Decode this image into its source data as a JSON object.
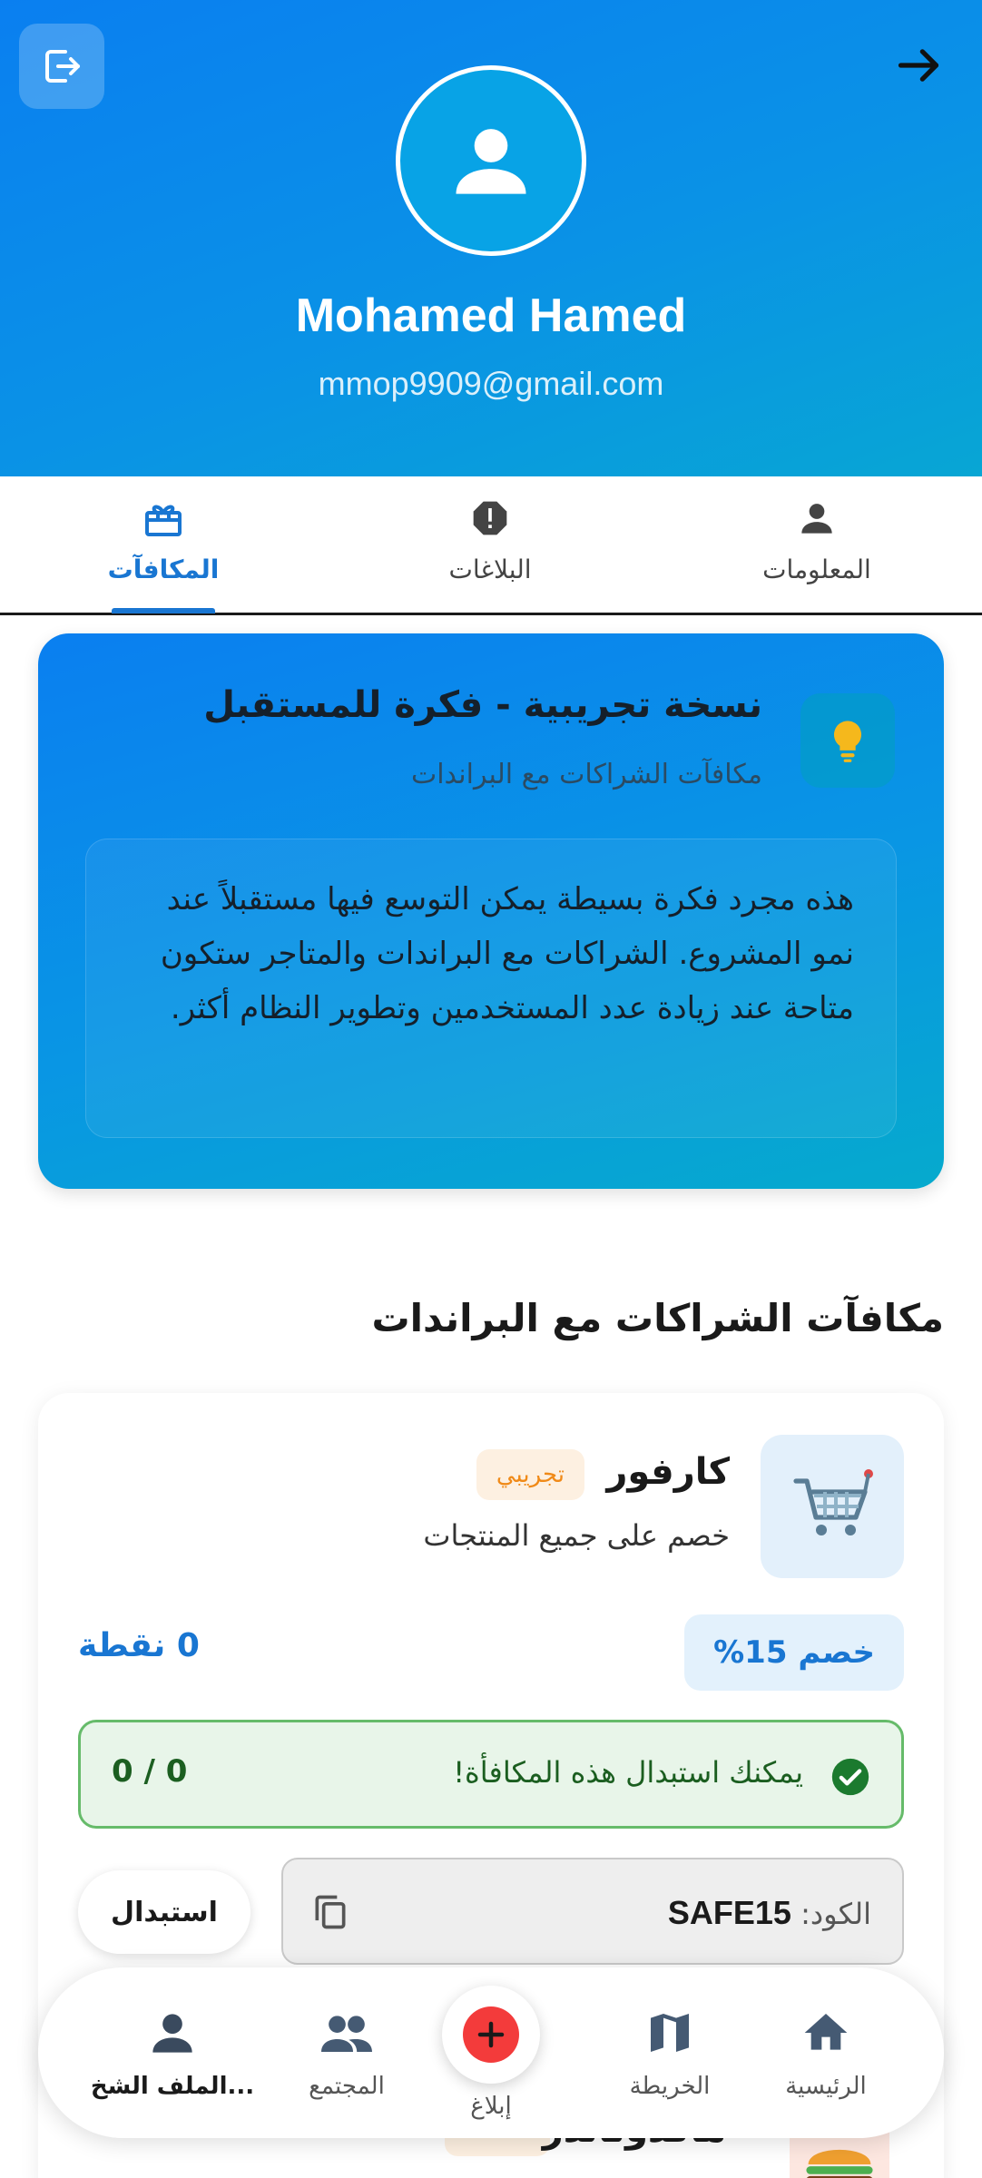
{
  "header": {
    "user_name": "Mohamed Hamed",
    "user_email": "mmop9909@gmail.com",
    "logout_icon": "logout-icon",
    "back_icon": "arrow-right-icon",
    "avatar_icon": "person-icon"
  },
  "tabs": [
    {
      "label": "المعلومات",
      "icon": "person-icon",
      "active": false
    },
    {
      "label": "البلاغات",
      "icon": "alert-icon",
      "active": false
    },
    {
      "label": "المكافآت",
      "icon": "gift-icon",
      "active": true
    }
  ],
  "info_card": {
    "title": "نسخة تجريبية - فكرة للمستقبل",
    "subtitle": "مكافآت الشراكات مع البراندات",
    "body": "هذه مجرد فكرة بسيطة يمكن التوسع فيها مستقبلاً عند نمو المشروع. الشراكات مع البراندات والمتاجر ستكون متاحة عند زيادة عدد المستخدمين وتطوير النظام أكثر.",
    "icon": "lightbulb-icon"
  },
  "section_title": "مكافآت الشراكات مع البراندات",
  "reward": {
    "brand_name": "كارفور",
    "badge": "تجريبي",
    "description": "خصم على جميع المنتجات",
    "discount": "خصم 15%",
    "points": "0 نقطة",
    "status_text": "يمكنك استبدال هذه المكافأة!",
    "status_count": "0 / 0",
    "code_label": "الكود:",
    "code_value": "SAFE15",
    "redeem_label": "استبدال",
    "logo_icon": "shopping-cart-icon"
  },
  "next_reward": {
    "brand_name": "ماكدونالدز",
    "logo_icon": "burger-icon"
  },
  "bottom_nav": [
    {
      "label": "الرئيسية",
      "icon": "home-icon",
      "active": false
    },
    {
      "label": "الخريطة",
      "icon": "map-icon",
      "active": false
    },
    {
      "label": "إبلاغ",
      "icon": "add-icon",
      "active": false
    },
    {
      "label": "المجتمع",
      "icon": "people-icon",
      "active": false
    },
    {
      "label": "الملف الشخ...",
      "icon": "person-icon",
      "active": true
    }
  ],
  "colors": {
    "primary": "#1976d2",
    "header_gradient_start": "#0a7ff0",
    "header_gradient_end": "#08a6d4",
    "success": "#1b5e20",
    "trial_badge": "#f08a18",
    "fab": "#f33b3b"
  }
}
